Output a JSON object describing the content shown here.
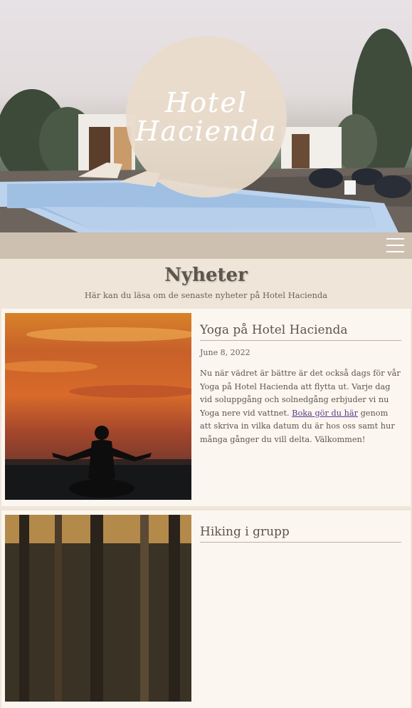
{
  "hero": {
    "logo_line1": "Hotel",
    "logo_line2": "Hacienda"
  },
  "nav": {
    "menu_icon": "hamburger-menu-icon"
  },
  "header": {
    "title": "Nyheter",
    "subtitle": "Här kan du läsa om de senaste nyheter på Hotel Hacienda"
  },
  "articles": [
    {
      "title": "Yoga på Hotel Hacienda",
      "date": "June 8, 2022",
      "text_before": "Nu när vädret är bättre är det också dags för vår Yoga på Hotel Hacienda att flytta ut. Varje dag vid soluppgång och solnedgång erbjuder vi nu Yoga nere vid vattnet. ",
      "link_text": "Boka gör du här",
      "text_after": " genom att skriva in vilka datum du är hos oss samt hur många gånger du vill delta. Välkommen!"
    },
    {
      "title": "Hiking i grupp"
    }
  ],
  "colors": {
    "background": "#efe6d9",
    "navbar": "#cdc0b0",
    "card": "#fbf6f0",
    "link": "#5b3d8a"
  }
}
